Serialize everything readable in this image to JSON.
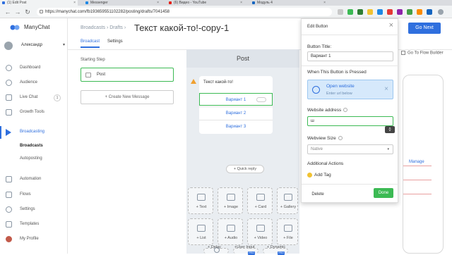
{
  "browser": {
    "tabs": [
      {
        "title": "(1) Edit Post",
        "active": true,
        "color": "#2f6fde"
      },
      {
        "title": "Messenger",
        "active": false,
        "color": "#1e88e5"
      },
      {
        "title": "(6) Видео - YouTube",
        "active": false,
        "color": "#e62117"
      },
      {
        "title": "Модуль 4",
        "active": false,
        "color": "#1565c0"
      }
    ],
    "url": "https://manychat.com/fb193659551102282/posting/drafts/7041458"
  },
  "sidebar": {
    "brand": "ManyChat",
    "user": "Александр",
    "items": [
      {
        "label": "Dashboard"
      },
      {
        "label": "Audience"
      },
      {
        "label": "Live Chat",
        "badge": "1"
      },
      {
        "label": "Growth Tools"
      },
      {
        "label": "Broadcasting"
      },
      {
        "label": "Automation"
      },
      {
        "label": "Flows"
      },
      {
        "label": "Settings"
      },
      {
        "label": "Templates"
      },
      {
        "label": "My Profile"
      }
    ],
    "sub": [
      "Broadcasts",
      "Autoposting"
    ]
  },
  "header": {
    "breadcrumb": "Broadcasts  ›  Drafts  ›",
    "title": "Текст какой-то!-copy-1",
    "tabs": [
      "Broadcast",
      "Settings"
    ],
    "go_next": "Go Next"
  },
  "steps": {
    "starting_label": "Starting Step",
    "post_label": "Post",
    "new_message": "+ Create New Message"
  },
  "editor": {
    "header": "Post",
    "message_text": "Текст какой-то!",
    "buttons": [
      "Вариант 1",
      "Вариант 2",
      "Вариант 3"
    ],
    "quick_reply": "+ Quick reply",
    "blocks": [
      {
        "label": "+ Text"
      },
      {
        "label": "+ Image"
      },
      {
        "label": "+ Card"
      },
      {
        "label": "+ Gallery"
      },
      {
        "label": "+ List"
      },
      {
        "label": "+ Audio"
      },
      {
        "label": "+ Video"
      },
      {
        "label": "+ File"
      },
      {
        "label": "+ Delay"
      },
      {
        "label": "+User Input",
        "pro": "PRO"
      },
      {
        "label": "+ Dynamic",
        "pro": "PRO"
      }
    ]
  },
  "edit_panel": {
    "title": "Edit Button",
    "button_title_label": "Button Title:",
    "button_title_value": "Вариант 1",
    "pressed_label": "When This Button is Pressed",
    "action_title": "Open website",
    "action_sub": "Enter url below",
    "website_label": "Website address",
    "website_value": "ш",
    "tooltip": "{}",
    "webview_label": "Webview Size",
    "webview_value": "Native",
    "additional_label": "Additional Actions",
    "add_tag": "Add Tag",
    "delete": "Delete",
    "done": "Done"
  },
  "right": {
    "flow_builder": "Go To Flow Builder",
    "manage": "Manage"
  },
  "colors": {
    "accent": "#2f6fde",
    "success": "#3cba54"
  }
}
